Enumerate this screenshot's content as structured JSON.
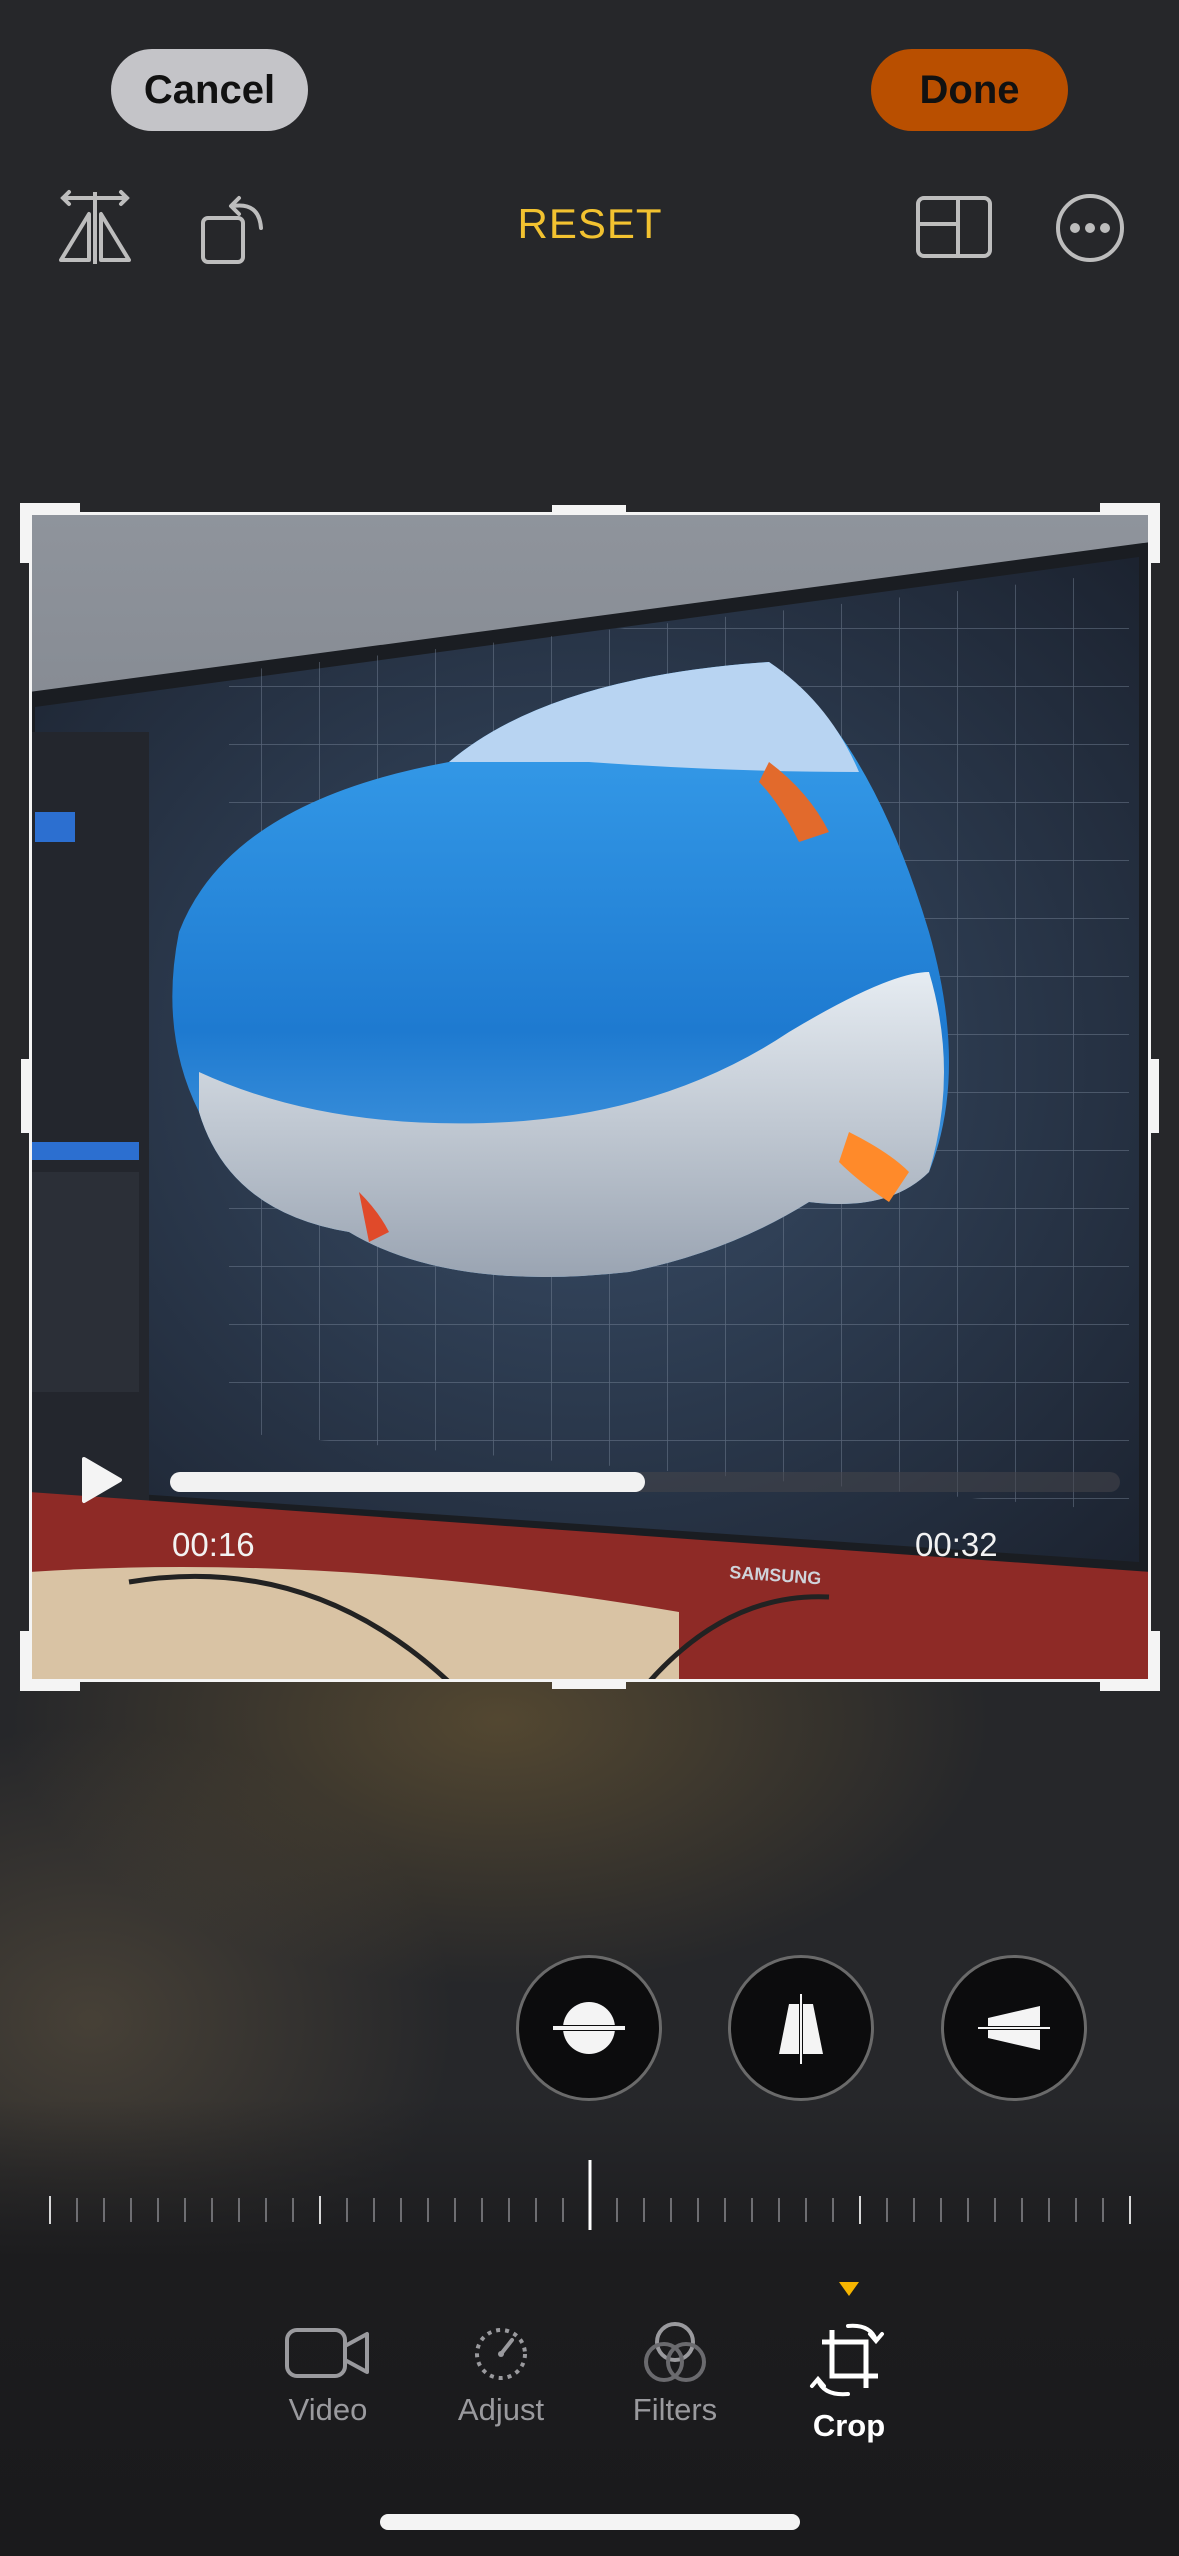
{
  "toolbar": {
    "cancel_label": "Cancel",
    "done_label": "Done",
    "reset_label": "RESET"
  },
  "icons": {
    "flip": "flip-horizontal-icon",
    "rotate": "rotate-icon",
    "aspect": "aspect-ratio-icon",
    "more": "more-options-icon",
    "play": "play-icon",
    "straighten": "straighten-icon",
    "vertical": "vertical-perspective-icon",
    "horizontal": "horizontal-perspective-icon"
  },
  "player": {
    "current_time": "00:16",
    "total_time": "00:32",
    "progress": 0.5
  },
  "photo": {
    "monitor_brand": "SAMSUNG"
  },
  "tabs": [
    {
      "label": "Video",
      "icon": "video-camera-icon",
      "active": false
    },
    {
      "label": "Adjust",
      "icon": "adjust-dial-icon",
      "active": false
    },
    {
      "label": "Filters",
      "icon": "filters-icon",
      "active": false
    },
    {
      "label": "Crop",
      "icon": "crop-rotate-icon",
      "active": true
    }
  ],
  "colors": {
    "accent_yellow": "#f2c230",
    "done_orange": "#b94f00",
    "indicator": "#f5b400"
  }
}
